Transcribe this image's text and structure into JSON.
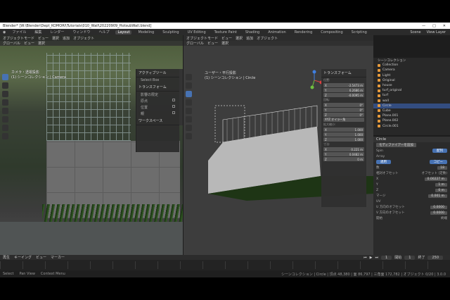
{
  "titlebar": {
    "title": "Blender* [W:\\Blender\\Dept_KOMORI\\Tutorials\\010_Wall\\20220909_HotsubWall.blend]",
    "minimize": "—",
    "maximize": "□",
    "close": "✕"
  },
  "menubar": {
    "menus": [
      "ファイル",
      "編集",
      "レンダー",
      "ウィンドウ",
      "ヘルプ"
    ],
    "workspaces": [
      "Layout",
      "Modeling",
      "Sculpting",
      "UV Editing",
      "Texture Paint",
      "Shading",
      "Animation",
      "Rendering",
      "Compositing",
      "Scripting"
    ],
    "active_workspace": "Layout",
    "scene": "Scene",
    "view_layer": "View Layer"
  },
  "left_view": {
    "header": [
      "オブジェクト",
      "ビュー",
      "選択",
      "追加",
      "オブジェクト"
    ],
    "mode": "オブジェクトモード",
    "header2": [
      "グローバル",
      "ビュー",
      "選択"
    ],
    "overlay": [
      "カメラ・透視投影",
      "(1) シーンコレクション | Camera"
    ],
    "npanel": {
      "title": "アクティブツール",
      "select_label": "Select Box",
      "transform_label": "トランスフォーム",
      "affect_label": "影響の限定",
      "affect_rows": [
        "原点",
        "位置",
        "親"
      ],
      "workspace_label": "ワークスペース"
    }
  },
  "mid_view": {
    "header": [
      "オブジェクトモード",
      "ビュー",
      "選択",
      "追加",
      "オブジェクト"
    ],
    "header2": [
      "グローバル",
      "ビュー",
      "選択"
    ],
    "overlay": [
      "ユーザー・平行投影",
      "(1) シーンコレクション | Circle"
    ],
    "transform_panel": {
      "title": "トランスフォーム",
      "location_label": "位置:",
      "location": [
        [
          "X",
          "-2.5473 m"
        ],
        [
          "Y",
          "6.2686 m"
        ],
        [
          "Z",
          "-0.0095 m"
        ]
      ],
      "rotation_label": "回転:",
      "rotation": [
        [
          "X",
          "0°"
        ],
        [
          "Y",
          "0°"
        ],
        [
          "Z",
          "0°"
        ]
      ],
      "rotation_mode": "XYZ オイラー角",
      "scale_label": "拡大縮小:",
      "scale": [
        [
          "X",
          "1.000"
        ],
        [
          "Y",
          "1.000"
        ],
        [
          "Z",
          "1.000"
        ]
      ],
      "dimensions_label": "寸法:",
      "dimensions": [
        [
          "X",
          "0.221 m"
        ],
        [
          "Y",
          "0.0482 m"
        ],
        [
          "Z",
          "0 m"
        ]
      ]
    }
  },
  "outliner": {
    "rows": [
      {
        "label": "シーンコレクション",
        "sel": false
      },
      {
        "label": "Collection",
        "sel": false
      },
      {
        "label": "Camera",
        "sel": false
      },
      {
        "label": "Light",
        "sel": false
      },
      {
        "label": "Original",
        "sel": false
      },
      {
        "label": "house",
        "sel": false
      },
      {
        "label": "turf_original",
        "sel": false
      },
      {
        "label": "turf",
        "sel": false
      },
      {
        "label": "wall",
        "sel": false
      },
      {
        "label": "Circle",
        "sel": true
      },
      {
        "label": "Cube",
        "sel": false
      },
      {
        "label": "Plane.001",
        "sel": false
      },
      {
        "label": "Plane.002",
        "sel": false
      },
      {
        "label": "Circle.001",
        "sel": false
      }
    ]
  },
  "properties": {
    "object": "Circle",
    "header": "モディファイアーを追加",
    "array_label": "Array",
    "row1": [
      "Spin",
      "配列"
    ],
    "count_label": "数",
    "count": "18",
    "relative_offset_label": "相対オフセット",
    "offsets": [
      [
        "X",
        "0.00227 m"
      ],
      [
        "Y",
        "1 m"
      ],
      [
        "Z",
        "0 m"
      ]
    ],
    "constant_offset_label": "オフセット (定数)",
    "merge_label": "マージ",
    "merge_distance": "0.001 m",
    "uv_label": "UV",
    "uv_offsets": [
      [
        "U 方向のオフセット",
        "0.0000"
      ],
      [
        "V 方向のオフセット",
        "0.0000"
      ]
    ],
    "caps": [
      "開始",
      "終端"
    ],
    "apply": "適用",
    "copy": "コピー"
  },
  "timeline": {
    "menus": [
      "再生",
      "キーイング",
      "ビュー",
      "マーカー"
    ],
    "current_frame": "1",
    "start_label": "開始",
    "start": "1",
    "end_label": "終了",
    "end": "250"
  },
  "statusbar": {
    "left": [
      "Select",
      "Pan View",
      "Context Menu"
    ],
    "right": "シーンコレクション | Circle | 頂点 48,380 | 面 86,797 | 三角面 172,782 | オブジェクト 0/20 | 3.0.0"
  }
}
